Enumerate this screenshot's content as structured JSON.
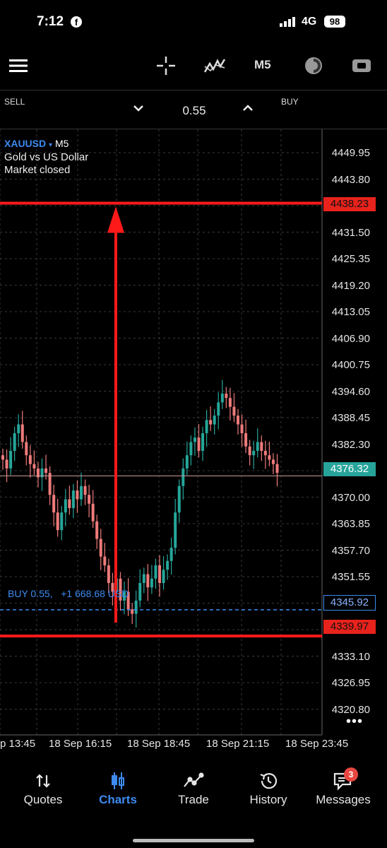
{
  "status_bar": {
    "time": "7:12",
    "facebook_icon": "f",
    "network": "4G",
    "battery": "98"
  },
  "toolbar": {
    "timeframe": "M5",
    "icons": [
      "menu-icon",
      "crosshair-icon",
      "indicators-icon",
      "timeframe",
      "objects-icon",
      "trade-panel-icon"
    ]
  },
  "trade_bar": {
    "sell_label": "SELL",
    "buy_label": "BUY",
    "lot": "0.55"
  },
  "symbol": {
    "name": "XAUUSD",
    "arrow": "▾",
    "timeframe": "M5",
    "description": "Gold vs US Dollar",
    "status": "Market closed"
  },
  "y_axis": [
    "4449.95",
    "4443.80",
    "4438.23",
    "4431.50",
    "4425.35",
    "4419.20",
    "4413.05",
    "4406.90",
    "4400.75",
    "4394.60",
    "4388.45",
    "4382.30",
    "4376.32",
    "4370.00",
    "4363.85",
    "4357.70",
    "4351.55",
    "4345.92",
    "4339.97",
    "4333.10",
    "4326.95",
    "4320.80"
  ],
  "x_axis": [
    "p 13:45",
    "18 Sep 16:15",
    "18 Sep 18:45",
    "18 Sep 21:15",
    "18 Sep 23:45"
  ],
  "price_tags": {
    "upper": "4438.23",
    "current": "4376.32",
    "position": "4345.92",
    "lower": "4339.97"
  },
  "position_label": "BUY 0.55,   +1 668.68 USD",
  "more_icon": "•••",
  "colors": {
    "bull": "#26a69a",
    "bear": "#ef7b7b",
    "marker": "#ff1a1a",
    "accent": "#3d8bf0"
  },
  "nav": [
    {
      "label": "Quotes",
      "icon": "sort-arrows-icon",
      "active": false
    },
    {
      "label": "Charts",
      "icon": "candles-icon",
      "active": true
    },
    {
      "label": "Trade",
      "icon": "trade-line-icon",
      "active": false
    },
    {
      "label": "History",
      "icon": "history-icon",
      "active": false
    },
    {
      "label": "Messages",
      "icon": "messages-icon",
      "active": false,
      "badge": "3"
    }
  ],
  "chart_data": {
    "type": "candlestick",
    "symbol": "XAUUSD",
    "timeframe": "M5",
    "ylim": [
      4317.5,
      4455.0
    ],
    "current_price": 4376.32,
    "horizontal_lines": [
      4438.23,
      4339.97
    ],
    "position_price": 4345.92,
    "close_series": [
      4380,
      4378,
      4382,
      4386,
      4388,
      4384,
      4381,
      4379,
      4378,
      4376,
      4378,
      4377,
      4372,
      4368,
      4364,
      4368,
      4371,
      4369,
      4373,
      4371,
      4374,
      4372,
      4370,
      4366,
      4362,
      4358,
      4356,
      4352,
      4350,
      4353,
      4348,
      4350,
      4346,
      4345,
      4348,
      4352,
      4354,
      4351,
      4353,
      4356,
      4352,
      4355,
      4357,
      4360,
      4368,
      4374,
      4378,
      4381,
      4384,
      4385,
      4382,
      4386,
      4389,
      4388,
      4390,
      4393,
      4395,
      4394,
      4392,
      4390,
      4388,
      4386,
      4383,
      4381,
      4382,
      4384,
      4382,
      4381,
      4380,
      4379,
      4377
    ]
  }
}
